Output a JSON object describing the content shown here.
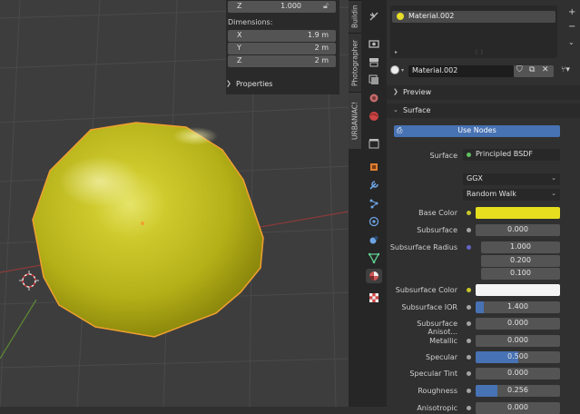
{
  "npanel": {
    "z_rotation_label": "Z",
    "z_rotation_value": "1.000",
    "dimensions_label": "Dimensions:",
    "dims": [
      {
        "label": "X",
        "value": "1.9 m"
      },
      {
        "label": "Y",
        "value": "2 m"
      },
      {
        "label": "Z",
        "value": "2 m"
      }
    ],
    "properties_label": "Properties"
  },
  "vertical_tabs": [
    "Buildin",
    "Photographer",
    "URBANIAC!"
  ],
  "material_slots": {
    "selected": "Material.002",
    "selector_value": "Material.002"
  },
  "sections": {
    "preview": "Preview",
    "surface": "Surface"
  },
  "surface": {
    "use_nodes_label": "Use Nodes",
    "surface_label": "Surface",
    "surface_value": "Principled BSDF",
    "distribution": "GGX",
    "subsurface_method": "Random Walk",
    "params": [
      {
        "label": "Base Color",
        "kind": "color",
        "color": "#e6de1e"
      },
      {
        "label": "Subsurface",
        "kind": "value",
        "value": "0.000",
        "fill": 0
      },
      {
        "label": "Subsurface Radius",
        "kind": "vector",
        "values": [
          "1.000",
          "0.200",
          "0.100"
        ]
      },
      {
        "label": "Subsurface Color",
        "kind": "color",
        "color": "#f4f4f4"
      },
      {
        "label": "Subsurface IOR",
        "kind": "value",
        "value": "1.400",
        "fill": 0.1
      },
      {
        "label": "Subsurface Anisot...",
        "kind": "value",
        "value": "0.000",
        "fill": 0
      },
      {
        "label": "Metallic",
        "kind": "value",
        "value": "0.000",
        "fill": 0
      },
      {
        "label": "Specular",
        "kind": "value",
        "value": "0.500",
        "fill": 0.5
      },
      {
        "label": "Specular Tint",
        "kind": "value",
        "value": "0.000",
        "fill": 0
      },
      {
        "label": "Roughness",
        "kind": "value",
        "value": "0.256",
        "fill": 0.256
      },
      {
        "label": "Anisotropic",
        "kind": "value",
        "value": "0.000",
        "fill": 0
      }
    ]
  },
  "colors": {
    "accent": "#4772b3",
    "object_color": "#c9c62e",
    "selection_outline": "#f0a030"
  }
}
